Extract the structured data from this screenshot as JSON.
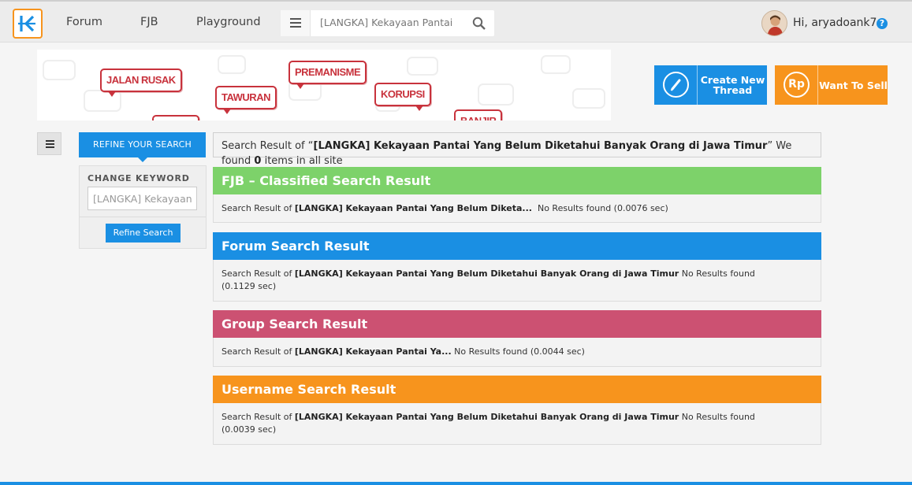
{
  "nav": {
    "links": [
      "Forum",
      "FJB",
      "Playground"
    ],
    "search": {
      "value": "[LANGKA] Kekayaan Pantai Ya"
    },
    "user": {
      "greeting": "Hi, aryadoank7",
      "help": "?"
    }
  },
  "banner": {
    "bubbles": [
      "JALAN RUSAK",
      "PREMANISME",
      "TAWURAN",
      "KORUPSI",
      "BANJIR"
    ]
  },
  "actions": {
    "create_thread": "Create New Thread",
    "want_to_sell": "Want To Sell",
    "sell_icon_text": "Rp"
  },
  "sidebar": {
    "refine_tab": "REFINE YOUR SEARCH",
    "change_keyword_label": "CHANGE KEYWORD",
    "keyword_value": "[LANGKA] Kekayaan",
    "refine_button": "Refine Search"
  },
  "summary": {
    "prefix": "Search Result of “",
    "query": "[LANGKA] Kekayaan Pantai Yang Belum Diketahui Banyak Orang di Jawa Timur",
    "middle": "” We found ",
    "count": "0",
    "suffix": " items in all site"
  },
  "sections": {
    "fjb": {
      "title": "FJB – Classified Search Result",
      "color": "#7dd26a",
      "prefix": "Search Result of ",
      "term": "[LANGKA] Kekayaan Pantai Yang Belum Diketa...",
      "result": "  No Results found (0.0076 sec)"
    },
    "forum": {
      "title": "Forum Search Result",
      "color": "#1a8fe3",
      "prefix": "Search Result of ",
      "term": "[LANGKA] Kekayaan Pantai Yang Belum Diketahui Banyak Orang di Jawa Timur",
      "result": " No Results found",
      "time": "(0.1129 sec)"
    },
    "group": {
      "title": "Group Search Result",
      "color": "#cc5172",
      "prefix": "Search Result of ",
      "term": "[LANGKA] Kekayaan Pantai Ya...",
      "result": " No Results found (0.0044 sec)"
    },
    "username": {
      "title": "Username Search Result",
      "color": "#f7941d",
      "prefix": "Search Result of ",
      "term": "[LANGKA] Kekayaan Pantai Yang Belum Diketahui Banyak Orang di Jawa Timur",
      "result": " No Results found",
      "time": "(0.0039 sec)"
    }
  }
}
